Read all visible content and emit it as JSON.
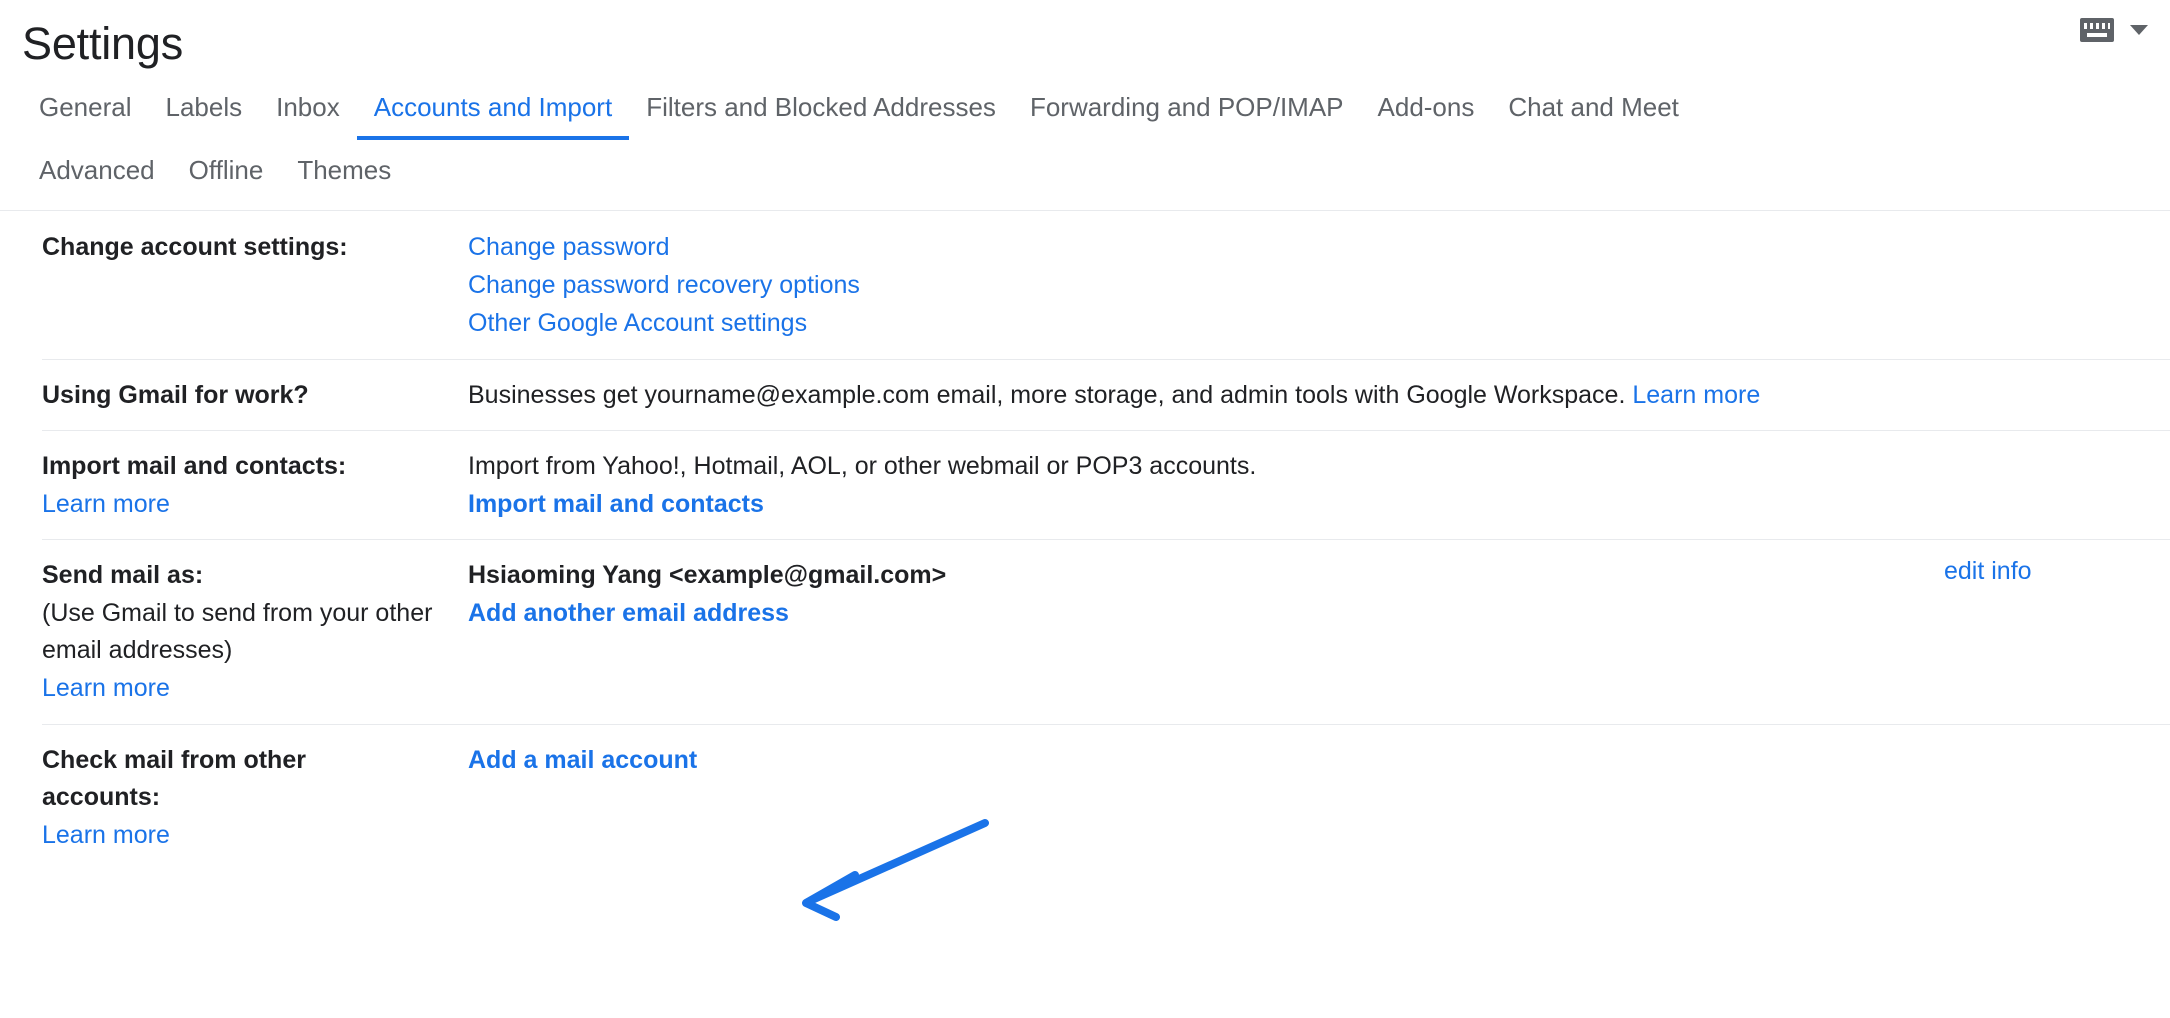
{
  "header": {
    "title": "Settings",
    "keyboard_icon": "keyboard-icon",
    "chevron_icon": "chevron-down-icon"
  },
  "tabs": {
    "row1": [
      {
        "label": "General",
        "active": false
      },
      {
        "label": "Labels",
        "active": false
      },
      {
        "label": "Inbox",
        "active": false
      },
      {
        "label": "Accounts and Import",
        "active": true
      },
      {
        "label": "Filters and Blocked Addresses",
        "active": false
      },
      {
        "label": "Forwarding and POP/IMAP",
        "active": false
      },
      {
        "label": "Add-ons",
        "active": false
      },
      {
        "label": "Chat and Meet",
        "active": false
      }
    ],
    "row2": [
      {
        "label": "Advanced",
        "active": false
      },
      {
        "label": "Offline",
        "active": false
      },
      {
        "label": "Themes",
        "active": false
      }
    ]
  },
  "sections": {
    "change_account": {
      "label": "Change account settings:",
      "links": [
        "Change password",
        "Change password recovery options",
        "Other Google Account settings"
      ]
    },
    "gmail_for_work": {
      "label": "Using Gmail for work?",
      "text": "Businesses get yourname@example.com email, more storage, and admin tools with Google Workspace.",
      "link": "Learn more"
    },
    "import_mail": {
      "label": "Import mail and contacts:",
      "label_link": "Learn more",
      "text": "Import from Yahoo!, Hotmail, AOL, or other webmail or POP3 accounts.",
      "action_link": "Import mail and contacts"
    },
    "send_mail_as": {
      "label": "Send mail as:",
      "note_line1": "(Use Gmail to send from your other",
      "note_line2": "email addresses)",
      "label_link": "Learn more",
      "address": "Hsiaoming Yang <example@gmail.com>",
      "action_link": "Add another email address",
      "edit_link": "edit info"
    },
    "check_mail": {
      "label_line1": "Check mail from other",
      "label_line2": "accounts:",
      "label_link": "Learn more",
      "action_link": "Add a mail account"
    }
  },
  "annotation": {
    "type": "arrow",
    "color": "#1a73e8",
    "points_to": "Add a mail account"
  },
  "colors": {
    "link": "#1a73e8",
    "text": "#202124",
    "muted": "#5f6368",
    "divider": "#e8eaed"
  }
}
